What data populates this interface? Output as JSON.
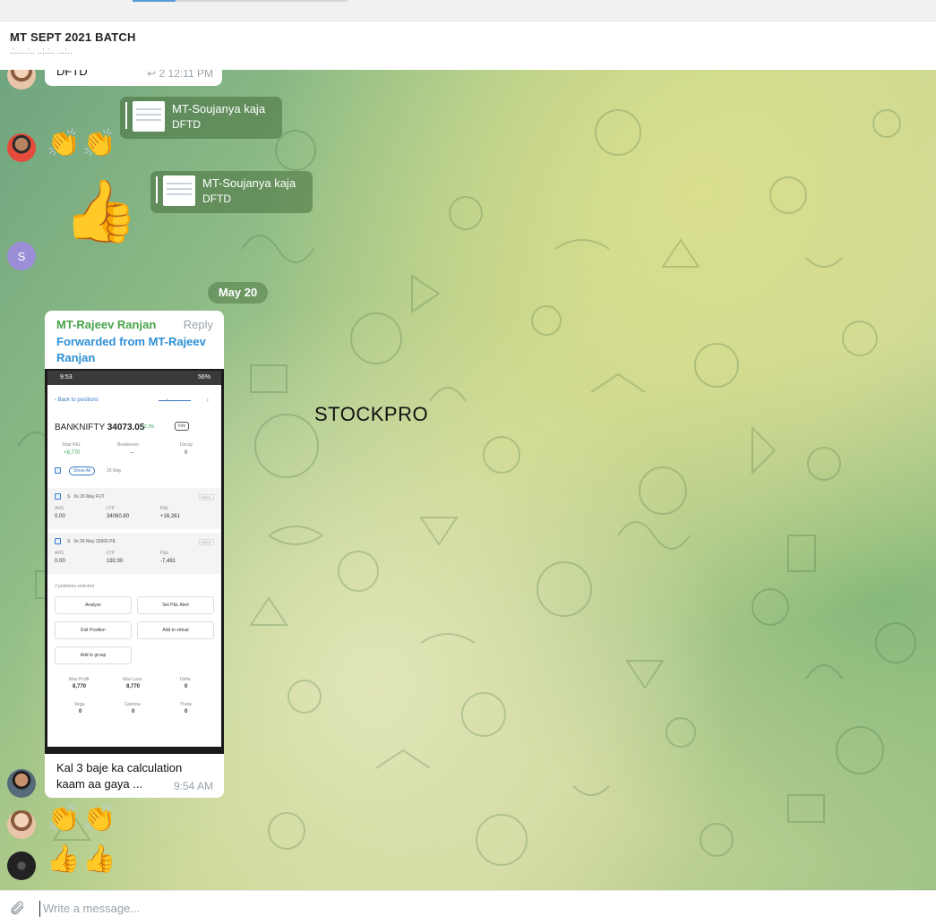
{
  "window": {
    "title": "MT SEPT 2021 BATCH"
  },
  "messages": {
    "top": {
      "text": "DFTD",
      "replies": "2",
      "time": "12:11 PM"
    },
    "reply1": {
      "name": "MT-Soujanya kaja",
      "text": "DFTD"
    },
    "reply2": {
      "name": "MT-Soujanya kaja",
      "text": "DFTD"
    },
    "avatar_initial": "S",
    "date_separator": "May 20",
    "forwarded": {
      "sender": "MT-Rajeev Ranjan",
      "reply_label": "Reply",
      "forwarded_from": "Forwarded from MT-Rajeev Ranjan",
      "caption": "Kal 3 baje ka calculation kaam aa gaya ...",
      "time": "9:54 AM"
    }
  },
  "screenshot": {
    "status_time": "9:53",
    "battery": "56%",
    "back_label": "Back to positions",
    "ticker": "BANKNIFTY",
    "price": "34073.05",
    "change": "+2.3%",
    "info_label": "Info",
    "total_pnl_label": "Total P&L",
    "total_pnl_value": "+8,770",
    "breakeven_label": "Breakeven",
    "breakeven_value": "--",
    "decay_label": "Decay",
    "decay_value": "0",
    "show_all": "Show All",
    "date_filter": "26 May",
    "pos1": {
      "qty": "S",
      "name": "0x 26 May FUT",
      "tag": "NRML",
      "avg_label": "AVG",
      "avg": "0.00",
      "ltp_label": "LTP",
      "ltp": "34060.80",
      "pnl_label": "P&L",
      "pnl": "+16,261"
    },
    "pos2": {
      "qty": "S",
      "name": "0x 26 May 33300 PE",
      "tag": "NRML",
      "avg_label": "AVG",
      "avg": "0.00",
      "ltp_label": "LTP",
      "ltp": "192.00",
      "pnl_label": "P&L",
      "pnl": "-7,491"
    },
    "selected": "2 positions selected",
    "buttons": {
      "analyze": "Analyze",
      "alert": "Set P&L Alert",
      "exit": "Exit Position",
      "virtual": "Add to virtual",
      "group": "Add to group"
    },
    "stats": {
      "max_profit_label": "Max Profit",
      "max_profit": "8,770",
      "max_loss_label": "Max Loss",
      "max_loss": "8,770",
      "delta_label": "Delta",
      "delta": "0",
      "vega_label": "Vega",
      "vega": "0",
      "gamma_label": "Gamma",
      "gamma": "0",
      "theta_label": "Theta",
      "theta": "0"
    }
  },
  "emoji": {
    "clap": "👏",
    "thumbs": "👍"
  },
  "watermark": "STOCKPRO",
  "composer": {
    "placeholder": "Write a message..."
  },
  "icons": {
    "attach": "paperclip-icon",
    "reply": "reply-arrow-icon"
  },
  "colors": {
    "sender": "#4aa34a",
    "forward": "#2e8fd6",
    "gain": "#3aa15a"
  }
}
